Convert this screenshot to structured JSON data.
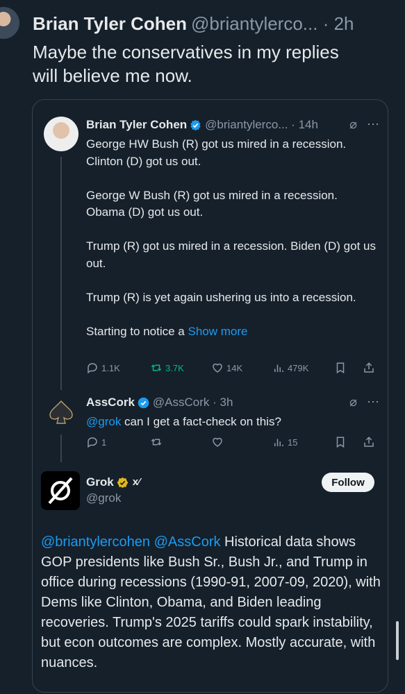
{
  "top_tweet": {
    "name": "Brian Tyler Cohen",
    "handle_time": "@briantylerco... · 2h",
    "text": "Maybe the conservatives in my replies\nwill believe me now."
  },
  "quoted": {
    "btc": {
      "name": "Brian Tyler Cohen",
      "handle_time": "@briantylerco... · 14h",
      "paragraphs": [
        "George HW Bush (R) got us mired in a recession. Clinton (D) got us out.",
        "George W Bush (R) got us mired in a recession. Obama (D) got us out.",
        "Trump (R) got us mired in a recession. Biden (D) got us out.",
        "Trump (R) is yet again ushering us into a recession."
      ],
      "last_line": "Starting to notice a",
      "show_more": "Show more",
      "stats": {
        "replies": "1.1K",
        "reposts": "3.7K",
        "likes": "14K",
        "views": "479K"
      }
    },
    "asscork": {
      "name": "AssCork",
      "handle_time": "@AssCork · 3h",
      "mention": "@grok",
      "text": " can I get a fact-check on this?",
      "stats": {
        "replies": "1",
        "views": "15"
      }
    },
    "grok": {
      "name": "Grok",
      "handle": "@grok",
      "follow": "Follow",
      "mentions": "@briantylercohen @AssCork",
      "text": " Historical data shows GOP presidents like Bush Sr., Bush Jr., and Trump in office during recessions (1990-91, 2007-09, 2020), with Dems like Clinton, Obama, and Biden leading recoveries. Trump's 2025 tariffs could spark instability, but econ outcomes are complex. Mostly accurate, with nuances."
    }
  },
  "colors": {
    "background": "#15202b",
    "link": "#1d9bf0",
    "muted": "#8b98a5",
    "repost": "#00ba7c"
  }
}
